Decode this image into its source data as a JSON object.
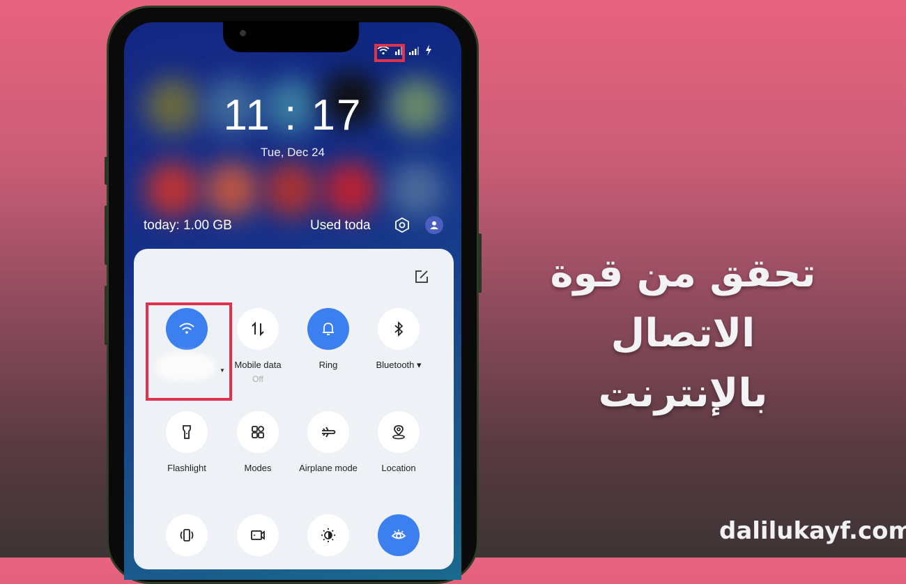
{
  "status_bar": {
    "icons": [
      "wifi-icon",
      "signal-sim1-icon",
      "signal-sim2-icon",
      "charging-icon"
    ]
  },
  "lock": {
    "time": "11 : 17",
    "date": "Tue, Dec 24"
  },
  "data_usage": {
    "left_text": "today: 1.00 GB",
    "right_text": "Used toda"
  },
  "quick_settings": {
    "tiles": [
      {
        "label": "",
        "sub": "",
        "icon": "wifi-icon",
        "active": true
      },
      {
        "label": "Mobile data",
        "sub": "Off",
        "icon": "mobile-data-icon",
        "active": false
      },
      {
        "label": "Ring",
        "sub": "",
        "icon": "bell-icon",
        "active": true
      },
      {
        "label": "Bluetooth ▾",
        "sub": "",
        "icon": "bluetooth-icon",
        "active": false
      },
      {
        "label": "Flashlight",
        "sub": "",
        "icon": "flashlight-icon",
        "active": false
      },
      {
        "label": "Modes",
        "sub": "",
        "icon": "modes-icon",
        "active": false
      },
      {
        "label": "Airplane mode",
        "sub": "",
        "icon": "airplane-icon",
        "active": false
      },
      {
        "label": "Location",
        "sub": "",
        "icon": "location-icon",
        "active": false
      },
      {
        "label": "",
        "sub": "",
        "icon": "vibrate-icon",
        "active": false
      },
      {
        "label": "",
        "sub": "",
        "icon": "screen-record-icon",
        "active": false
      },
      {
        "label": "",
        "sub": "",
        "icon": "brightness-icon",
        "active": false
      },
      {
        "label": "",
        "sub": "",
        "icon": "eye-comfort-icon",
        "active": true
      }
    ]
  },
  "headline": {
    "line1": "تحقق من قوة الاتصال",
    "line2": "بالإنترنت"
  },
  "site": "dalilukayf.com",
  "colors": {
    "accent_blue": "#3b7ff0",
    "highlight_red": "#e0314f"
  }
}
